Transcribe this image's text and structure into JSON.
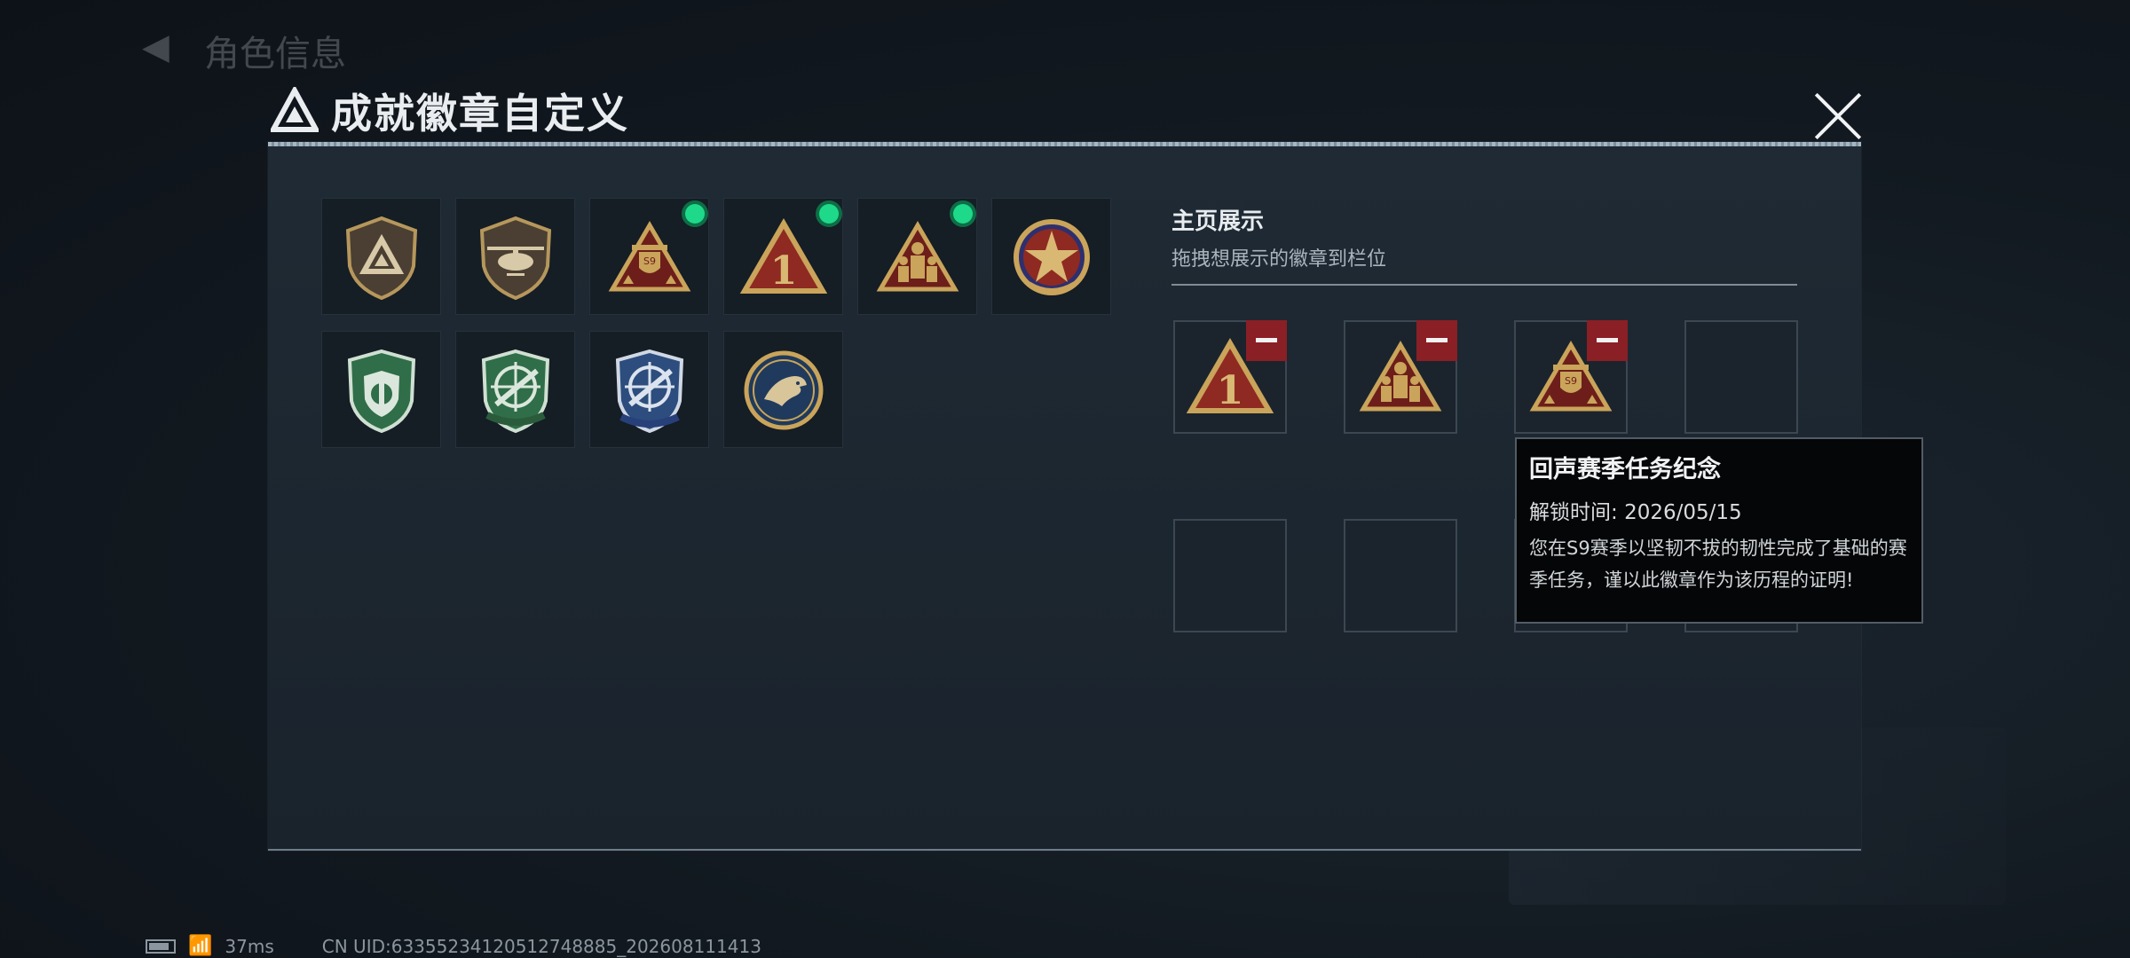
{
  "background": {
    "screen_title": "角色信息"
  },
  "modal": {
    "title": "成就徽章自定义"
  },
  "badges": [
    {
      "icon": "delta-shield-badge-icon",
      "selected": false
    },
    {
      "icon": "helicopter-shield-badge-icon",
      "selected": false
    },
    {
      "icon": "s9-season-triangle-badge-icon",
      "selected": true
    },
    {
      "icon": "number-one-triangle-badge-icon",
      "selected": true
    },
    {
      "icon": "soldiers-triangle-badge-icon",
      "selected": true
    },
    {
      "icon": "star-medallion-badge-icon",
      "selected": false
    },
    {
      "icon": "green-shield-badge-icon",
      "selected": false
    },
    {
      "icon": "green-crosshair-rifle-badge-icon",
      "selected": false
    },
    {
      "icon": "blue-crosshair-rifle-badge-icon",
      "selected": false
    },
    {
      "icon": "eagle-coin-badge-icon",
      "selected": false
    }
  ],
  "showcase": {
    "heading": "主页展示",
    "instruction": "拖拽想展示的徽章到栏位",
    "slots": [
      {
        "icon": "number-one-triangle-badge-icon",
        "filled": true
      },
      {
        "icon": "soldiers-triangle-badge-icon",
        "filled": true
      },
      {
        "icon": "s9-season-triangle-badge-icon",
        "filled": true
      },
      {
        "icon": "",
        "filled": false
      },
      {
        "icon": "",
        "filled": false
      },
      {
        "icon": "",
        "filled": false
      },
      {
        "icon": "",
        "filled": false
      },
      {
        "icon": "",
        "filled": false
      }
    ]
  },
  "tooltip": {
    "title": "回声赛季任务纪念",
    "unlock_label": "解锁时间:",
    "unlock_date": "2026/05/15",
    "description": "您在S9赛季以坚韧不拔的韧性完成了基础的赛季任务，谨以此徽章作为该历程的证明!"
  },
  "status": {
    "ping": "37ms",
    "uid": "CN UID:6335523412051274888​5_202608111413"
  },
  "colors": {
    "accent_green": "#1fd98a",
    "remove_red": "#8a1f25",
    "badge_gold": "#c9a45a",
    "badge_red": "#8e2a22"
  }
}
